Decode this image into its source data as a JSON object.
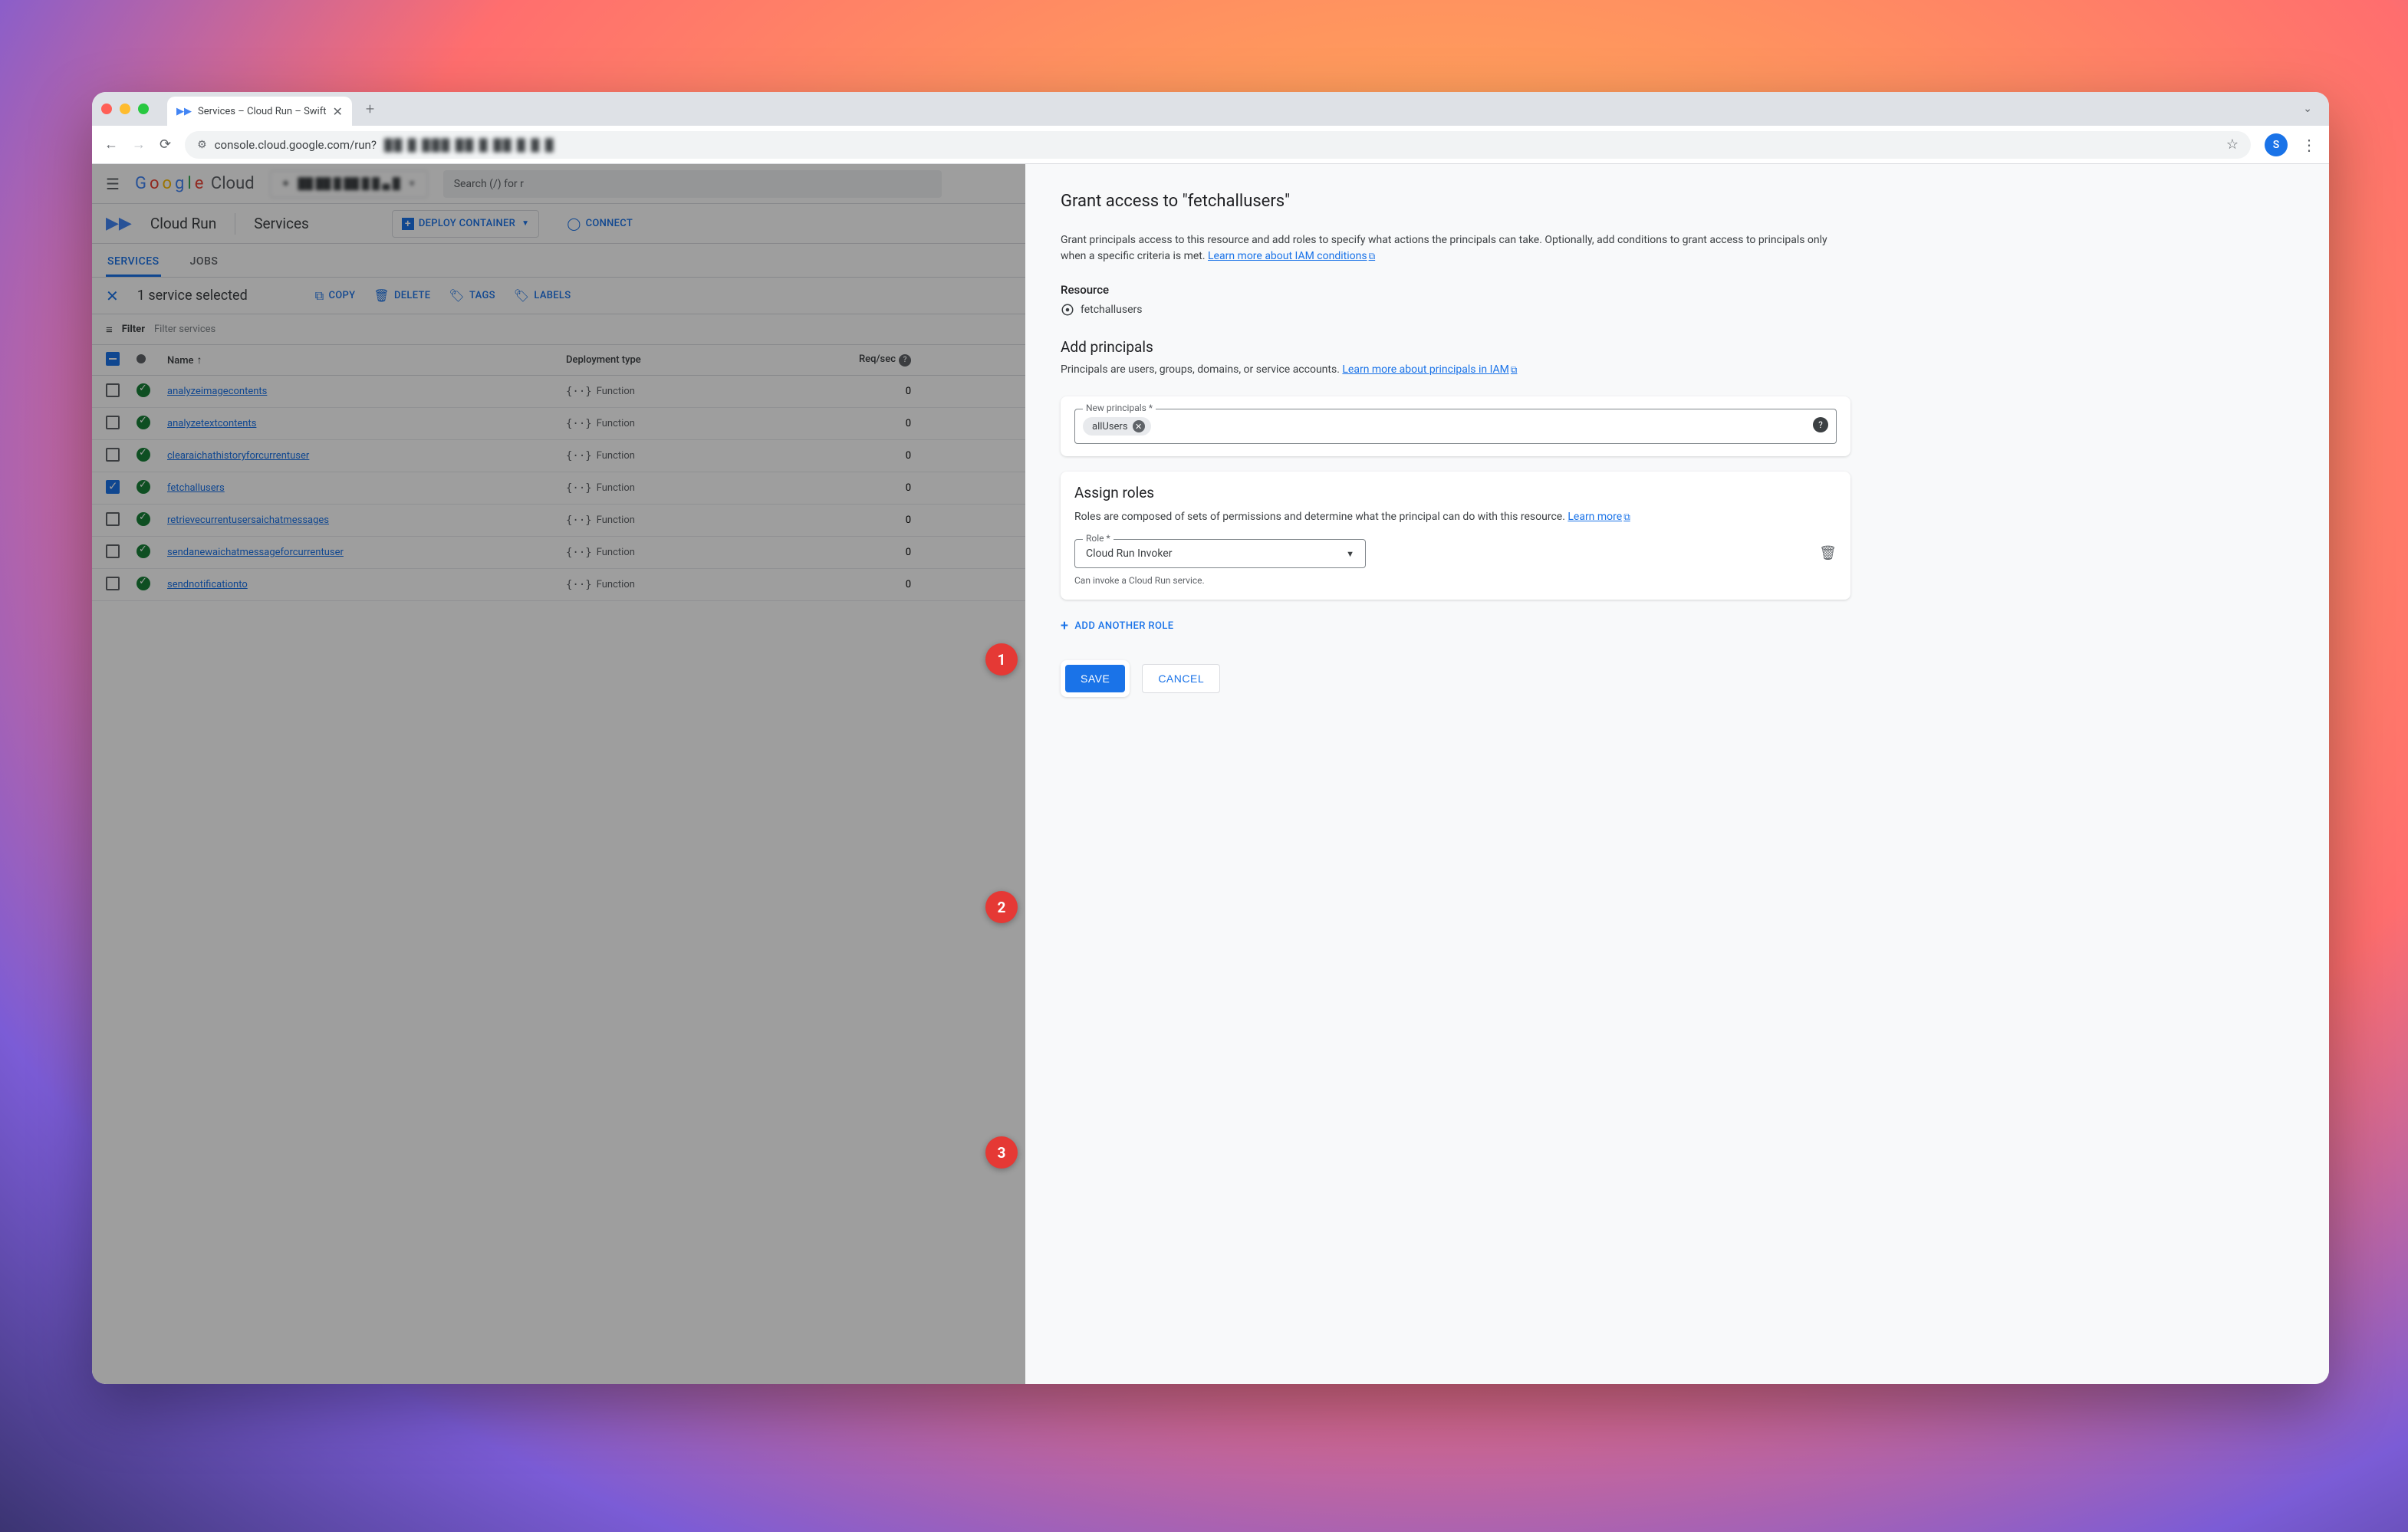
{
  "browser": {
    "tab_title": "Services – Cloud Run – Swift",
    "url": "console.cloud.google.com/run?",
    "url_obscured": "██ █ ███  ██ █ ██ █  █ █",
    "avatar_letter": "S"
  },
  "gcp_header": {
    "logo": "Google Cloud",
    "project_obscured": "██ ██ █ ██  █ █ ▄ █",
    "search_placeholder": "Search (/) for r"
  },
  "breadcrumb": {
    "product": "Cloud Run",
    "section": "Services",
    "deploy_btn": "DEPLOY CONTAINER",
    "connect_btn": "CONNECT"
  },
  "subtabs": {
    "services": "SERVICES",
    "jobs": "JOBS"
  },
  "selection": {
    "text": "1 service selected",
    "copy": "COPY",
    "delete": "DELETE",
    "tags": "TAGS",
    "labels": "LABELS"
  },
  "filter": {
    "label": "Filter",
    "placeholder": "Filter services"
  },
  "table": {
    "cols": {
      "name": "Name",
      "dep": "Deployment type",
      "req": "Req/sec"
    },
    "func_label": "Function",
    "rows": [
      {
        "name": "analyzeimagecontents",
        "req": "0",
        "checked": false
      },
      {
        "name": "analyzetextcontents",
        "req": "0",
        "checked": false
      },
      {
        "name": "clearaichathistoryforcurrentuser",
        "req": "0",
        "checked": false
      },
      {
        "name": "fetchallusers",
        "req": "0",
        "checked": true
      },
      {
        "name": "retrievecurrentusersaichatmessages",
        "req": "0",
        "checked": false
      },
      {
        "name": "sendanewaichatmessageforcurrentuser",
        "req": "0",
        "checked": false
      },
      {
        "name": "sendnotificationto",
        "req": "0",
        "checked": false
      }
    ]
  },
  "panel": {
    "title": "Grant access to \"fetchallusers\"",
    "desc": "Grant principals access to this resource and add roles to specify what actions the principals can take. Optionally, add conditions to grant access to principals only when a specific criteria is met. ",
    "learn_iam": "Learn more about IAM conditions",
    "resource_h": "Resource",
    "resource_name": "fetchallusers",
    "add_principals_h": "Add principals",
    "add_principals_desc": "Principals are users, groups, domains, or service accounts. ",
    "learn_principals": "Learn more about principals in IAM",
    "new_principals_label": "New principals *",
    "chip": "allUsers",
    "assign_roles_h": "Assign roles",
    "assign_roles_desc": "Roles are composed of sets of permissions and determine what the principal can do with this resource. ",
    "learn_roles": "Learn more",
    "role_label": "Role *",
    "role_value": "Cloud Run Invoker",
    "role_hint": "Can invoke a Cloud Run service.",
    "add_another": "ADD ANOTHER ROLE",
    "save": "SAVE",
    "cancel": "CANCEL"
  },
  "callouts": {
    "c1": "1",
    "c2": "2",
    "c3": "3"
  }
}
